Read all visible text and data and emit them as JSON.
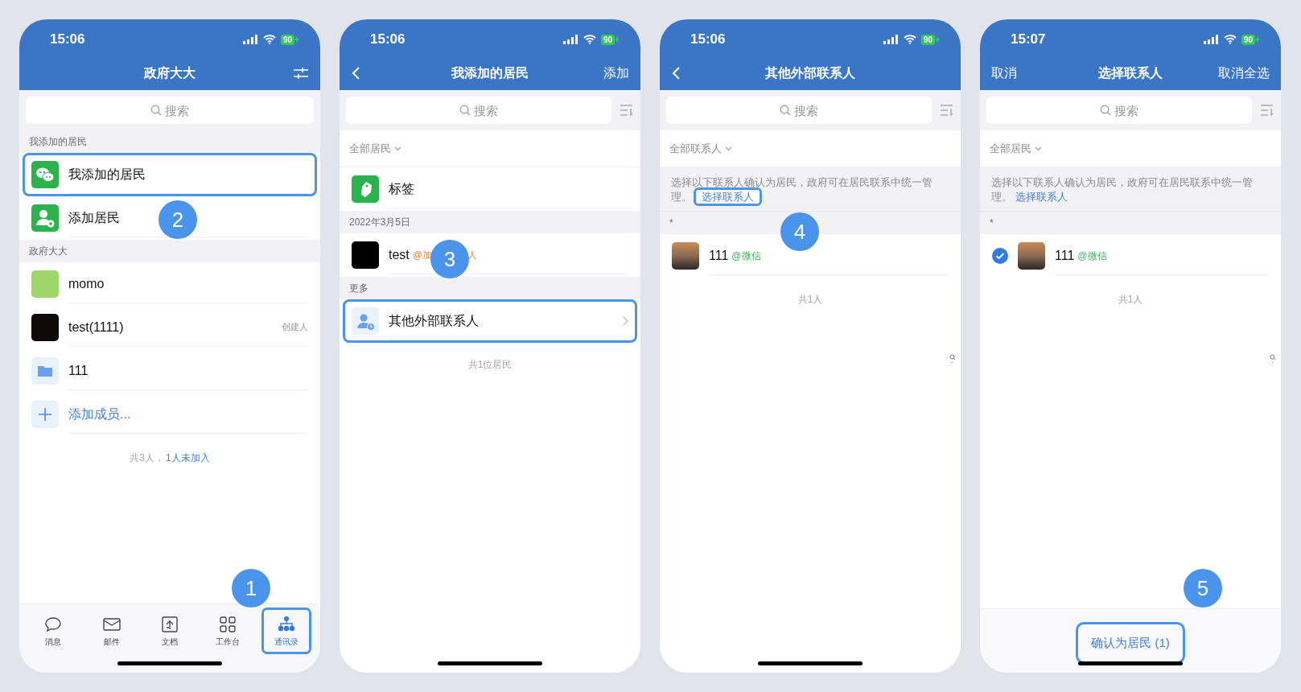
{
  "screens": [
    {
      "status": {
        "time": "15:06",
        "battery": "90"
      },
      "nav": {
        "title": "政府大大",
        "right": {
          "kind": "icon"
        }
      },
      "blocks": [
        {
          "kind": "search",
          "placeholder": "搜索",
          "sort": false
        },
        {
          "kind": "header",
          "text": "我添加的居民"
        },
        {
          "kind": "row",
          "label": "我添加的居民",
          "highlighted": true
        },
        {
          "kind": "row",
          "label": "添加居民",
          "highlighted": false
        },
        {
          "kind": "header",
          "text": "政府大大"
        },
        {
          "kind": "row",
          "label": "momo",
          "highlighted": false
        },
        {
          "kind": "row",
          "label": "test(1111)",
          "meta": "创建人",
          "highlighted": false
        },
        {
          "kind": "row",
          "label": "111",
          "highlighted": false
        },
        {
          "kind": "row",
          "label": "添加成员...",
          "link": true,
          "highlighted": false
        },
        {
          "kind": "footer",
          "text": "共3人，",
          "link": "1人未加入"
        }
      ],
      "tabbar": [
        {
          "label": "消息",
          "selected": false,
          "highlighted": false
        },
        {
          "label": "邮件",
          "selected": false,
          "highlighted": false
        },
        {
          "label": "文档",
          "selected": false,
          "highlighted": false
        },
        {
          "label": "工作台",
          "selected": false,
          "highlighted": false
        },
        {
          "label": "通讯录",
          "selected": true,
          "highlighted": true
        }
      ],
      "badges": [
        "1",
        "2"
      ]
    },
    {
      "status": {
        "time": "15:06",
        "battery": "90"
      },
      "nav": {
        "left": {
          "kind": "back"
        },
        "title": "我添加的居民",
        "right": {
          "kind": "text",
          "text": "添加"
        }
      },
      "blocks": [
        {
          "kind": "search",
          "placeholder": "搜索",
          "sort": true
        },
        {
          "kind": "filter",
          "text": "全部居民"
        },
        {
          "kind": "row",
          "label": "标签",
          "highlighted": false
        },
        {
          "kind": "header",
          "text": "2022年3月5日"
        },
        {
          "kind": "row",
          "label": "test",
          "tag": "@加",
          "tag_end": "人",
          "highlighted": false
        },
        {
          "kind": "header",
          "text": "更多"
        },
        {
          "kind": "row",
          "label": "其他外部联系人",
          "chevron": true,
          "highlighted": true
        },
        {
          "kind": "footer",
          "text": "共1位居民"
        }
      ],
      "badges": [
        "3"
      ]
    },
    {
      "status": {
        "time": "15:06",
        "battery": "90"
      },
      "nav": {
        "left": {
          "kind": "back"
        },
        "title": "其他外部联系人"
      },
      "blocks": [
        {
          "kind": "search",
          "placeholder": "搜索",
          "sort": true
        },
        {
          "kind": "filter",
          "text": "全部联系人"
        },
        {
          "kind": "note",
          "text": "选择以下联系人确认为居民，政府可在居民联系中统一管理。",
          "link": "选择联系人",
          "link_highlighted": true
        },
        {
          "kind": "header",
          "text": "*"
        },
        {
          "kind": "row",
          "label": "111",
          "tag": "@微信",
          "highlighted": false
        },
        {
          "kind": "footer",
          "text": "共1人"
        }
      ],
      "badges": [
        "4"
      ]
    },
    {
      "status": {
        "time": "15:07",
        "battery": "90"
      },
      "nav": {
        "left": {
          "kind": "text",
          "text": "取消"
        },
        "title": "选择联系人",
        "right": {
          "kind": "text",
          "text": "取消全选"
        }
      },
      "blocks": [
        {
          "kind": "search",
          "placeholder": "搜索",
          "sort": true
        },
        {
          "kind": "filter",
          "text": "全部居民"
        },
        {
          "kind": "note",
          "text": "选择以下联系人确认为居民，政府可在居民联系中统一管理。",
          "link": "选择联系人",
          "link_highlighted": false
        },
        {
          "kind": "header",
          "text": "*"
        },
        {
          "kind": "row",
          "label": "111",
          "tag": "@微信",
          "checked": true,
          "highlighted": false
        },
        {
          "kind": "footer",
          "text": "共1人"
        }
      ],
      "button": {
        "label": "确认为居民 (1)",
        "highlighted": true
      },
      "badges": [
        "5"
      ]
    }
  ]
}
